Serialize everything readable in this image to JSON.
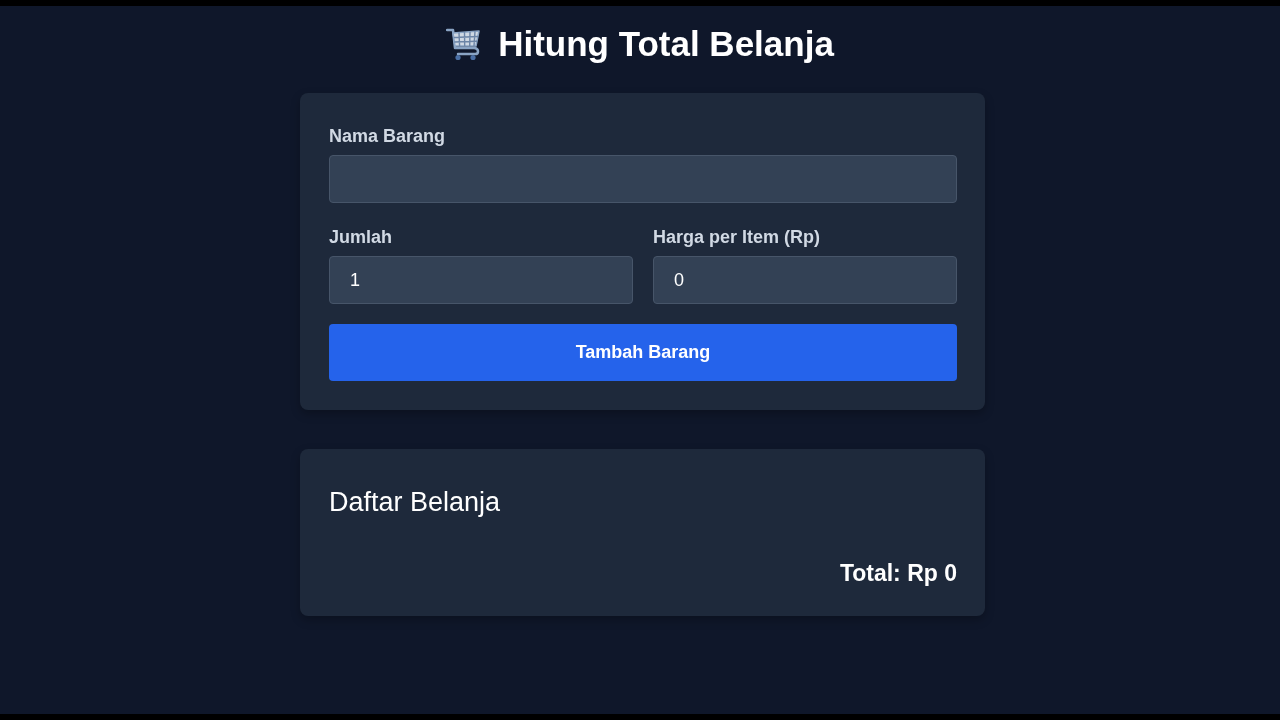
{
  "header": {
    "title": "Hitung Total Belanja"
  },
  "form": {
    "rows": [
      [
        {
          "label": "Nama Barang"
        }
      ],
      [
        {
          "label": "Jumlah",
          "value": "1"
        },
        {
          "label": "Harga per Item (Rp)",
          "value": "0"
        }
      ]
    ],
    "button": "Tambah Barang"
  },
  "shopping_list": {
    "title": "Daftar Belanja",
    "total": "Total: Rp 0"
  }
}
